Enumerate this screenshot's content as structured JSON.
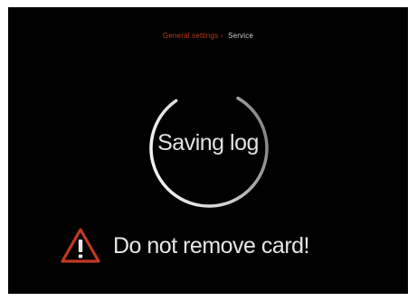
{
  "header": {
    "breadcrumb_parent": "General settings",
    "breadcrumb_separator": "›",
    "breadcrumb_current": "Service"
  },
  "progress": {
    "label": "Saving log",
    "arc_fraction": 0.82
  },
  "warning": {
    "icon": "warning-triangle-icon",
    "message": "Do not remove card!"
  },
  "colors": {
    "background": "#000000",
    "accent": "#c0391f",
    "text": "#e2e2e2",
    "ring": "#d8d8d8"
  }
}
